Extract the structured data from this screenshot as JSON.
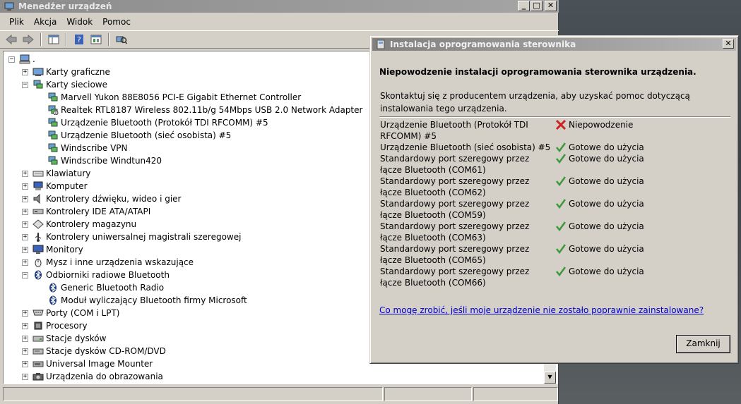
{
  "device_manager": {
    "title": "Menedżer urządzeń",
    "menu": [
      "Plik",
      "Akcja",
      "Widok",
      "Pomoc"
    ],
    "root_label": ".",
    "tree": [
      {
        "label": "Karty graficzne",
        "level": 1,
        "expander": "+",
        "icon": "display-adapter-icon"
      },
      {
        "label": "Karty sieciowe",
        "level": 1,
        "expander": "-",
        "icon": "network-adapter-icon"
      },
      {
        "label": "Marvell Yukon 88E8056 PCI-E Gigabit Ethernet Controller",
        "level": 2,
        "icon": "network-adapter-icon"
      },
      {
        "label": "Realtek RTL8187 Wireless 802.11b/g 54Mbps USB 2.0 Network Adapter",
        "level": 2,
        "icon": "network-adapter-disabled-icon"
      },
      {
        "label": "Urządzenie Bluetooth (Protokół TDI RFCOMM) #5",
        "level": 2,
        "icon": "network-adapter-icon"
      },
      {
        "label": "Urządzenie Bluetooth (sieć osobista) #5",
        "level": 2,
        "icon": "network-adapter-icon"
      },
      {
        "label": "Windscribe VPN",
        "level": 2,
        "icon": "network-adapter-icon"
      },
      {
        "label": "Windscribe Windtun420",
        "level": 2,
        "icon": "network-adapter-icon"
      },
      {
        "label": "Klawiatury",
        "level": 1,
        "expander": "+",
        "icon": "keyboard-icon"
      },
      {
        "label": "Komputer",
        "level": 1,
        "expander": "+",
        "icon": "computer-icon"
      },
      {
        "label": "Kontrolery dźwięku, wideo i gier",
        "level": 1,
        "expander": "+",
        "icon": "speaker-icon"
      },
      {
        "label": "Kontrolery IDE ATA/ATAPI",
        "level": 1,
        "expander": "+",
        "icon": "ide-controller-icon"
      },
      {
        "label": "Kontrolery magazynu",
        "level": 1,
        "expander": "+",
        "icon": "storage-controller-icon"
      },
      {
        "label": "Kontrolery uniwersalnej magistrali szeregowej",
        "level": 1,
        "expander": "+",
        "icon": "usb-icon"
      },
      {
        "label": "Monitory",
        "level": 1,
        "expander": "+",
        "icon": "monitor-icon"
      },
      {
        "label": "Mysz i inne urządzenia wskazujące",
        "level": 1,
        "expander": "+",
        "icon": "mouse-icon"
      },
      {
        "label": "Odbiorniki radiowe Bluetooth",
        "level": 1,
        "expander": "-",
        "icon": "bluetooth-icon"
      },
      {
        "label": "Generic Bluetooth Radio",
        "level": 2,
        "icon": "bluetooth-icon"
      },
      {
        "label": "Moduł wyliczający Bluetooth firmy Microsoft",
        "level": 2,
        "icon": "bluetooth-icon"
      },
      {
        "label": "Porty (COM i LPT)",
        "level": 1,
        "expander": "+",
        "icon": "port-icon"
      },
      {
        "label": "Procesory",
        "level": 1,
        "expander": "+",
        "icon": "processor-icon"
      },
      {
        "label": "Stacje dysków",
        "level": 1,
        "expander": "+",
        "icon": "disk-drive-icon"
      },
      {
        "label": "Stacje dysków CD-ROM/DVD",
        "level": 1,
        "expander": "+",
        "icon": "dvd-drive-icon"
      },
      {
        "label": "Universal Image Mounter",
        "level": 1,
        "expander": "+",
        "icon": "image-mounter-icon"
      },
      {
        "label": "Urządzenia do obrazowania",
        "level": 1,
        "expander": "+",
        "icon": "camera-icon"
      }
    ]
  },
  "dialog": {
    "title": "Instalacja oprogramowania sterownika",
    "header": "Niepowodzenie instalacji oprogramowania sterownika urządzenia.",
    "description": "Skontaktuj się z producentem urządzenia, aby uzyskać pomoc dotyczącą instalowania tego urządzenia.",
    "results": [
      {
        "name": "Urządzenie Bluetooth (Protokół TDI RFCOMM) #5",
        "status": "Niepowodzenie",
        "ok": false
      },
      {
        "name": "Urządzenie Bluetooth (sieć osobista) #5",
        "status": "Gotowe do użycia",
        "ok": true
      },
      {
        "name": "Standardowy port szeregowy przez łącze Bluetooth (COM61)",
        "status": "Gotowe do użycia",
        "ok": true
      },
      {
        "name": "Standardowy port szeregowy przez łącze Bluetooth (COM62)",
        "status": "Gotowe do użycia",
        "ok": true
      },
      {
        "name": "Standardowy port szeregowy przez łącze Bluetooth (COM59)",
        "status": "Gotowe do użycia",
        "ok": true
      },
      {
        "name": "Standardowy port szeregowy przez łącze Bluetooth (COM63)",
        "status": "Gotowe do użycia",
        "ok": true
      },
      {
        "name": "Standardowy port szeregowy przez łącze Bluetooth (COM65)",
        "status": "Gotowe do użycia",
        "ok": true
      },
      {
        "name": "Standardowy port szeregowy przez łącze Bluetooth (COM66)",
        "status": "Gotowe do użycia",
        "ok": true
      }
    ],
    "help_link": "Co mogę zrobić, jeśli moje urządzenie nie zostało poprawnie zainstalowane?",
    "close_button": "Zamknij"
  },
  "colors": {
    "fail": "#cc2222",
    "ok": "#3c9a3c",
    "link": "#0000cc"
  }
}
